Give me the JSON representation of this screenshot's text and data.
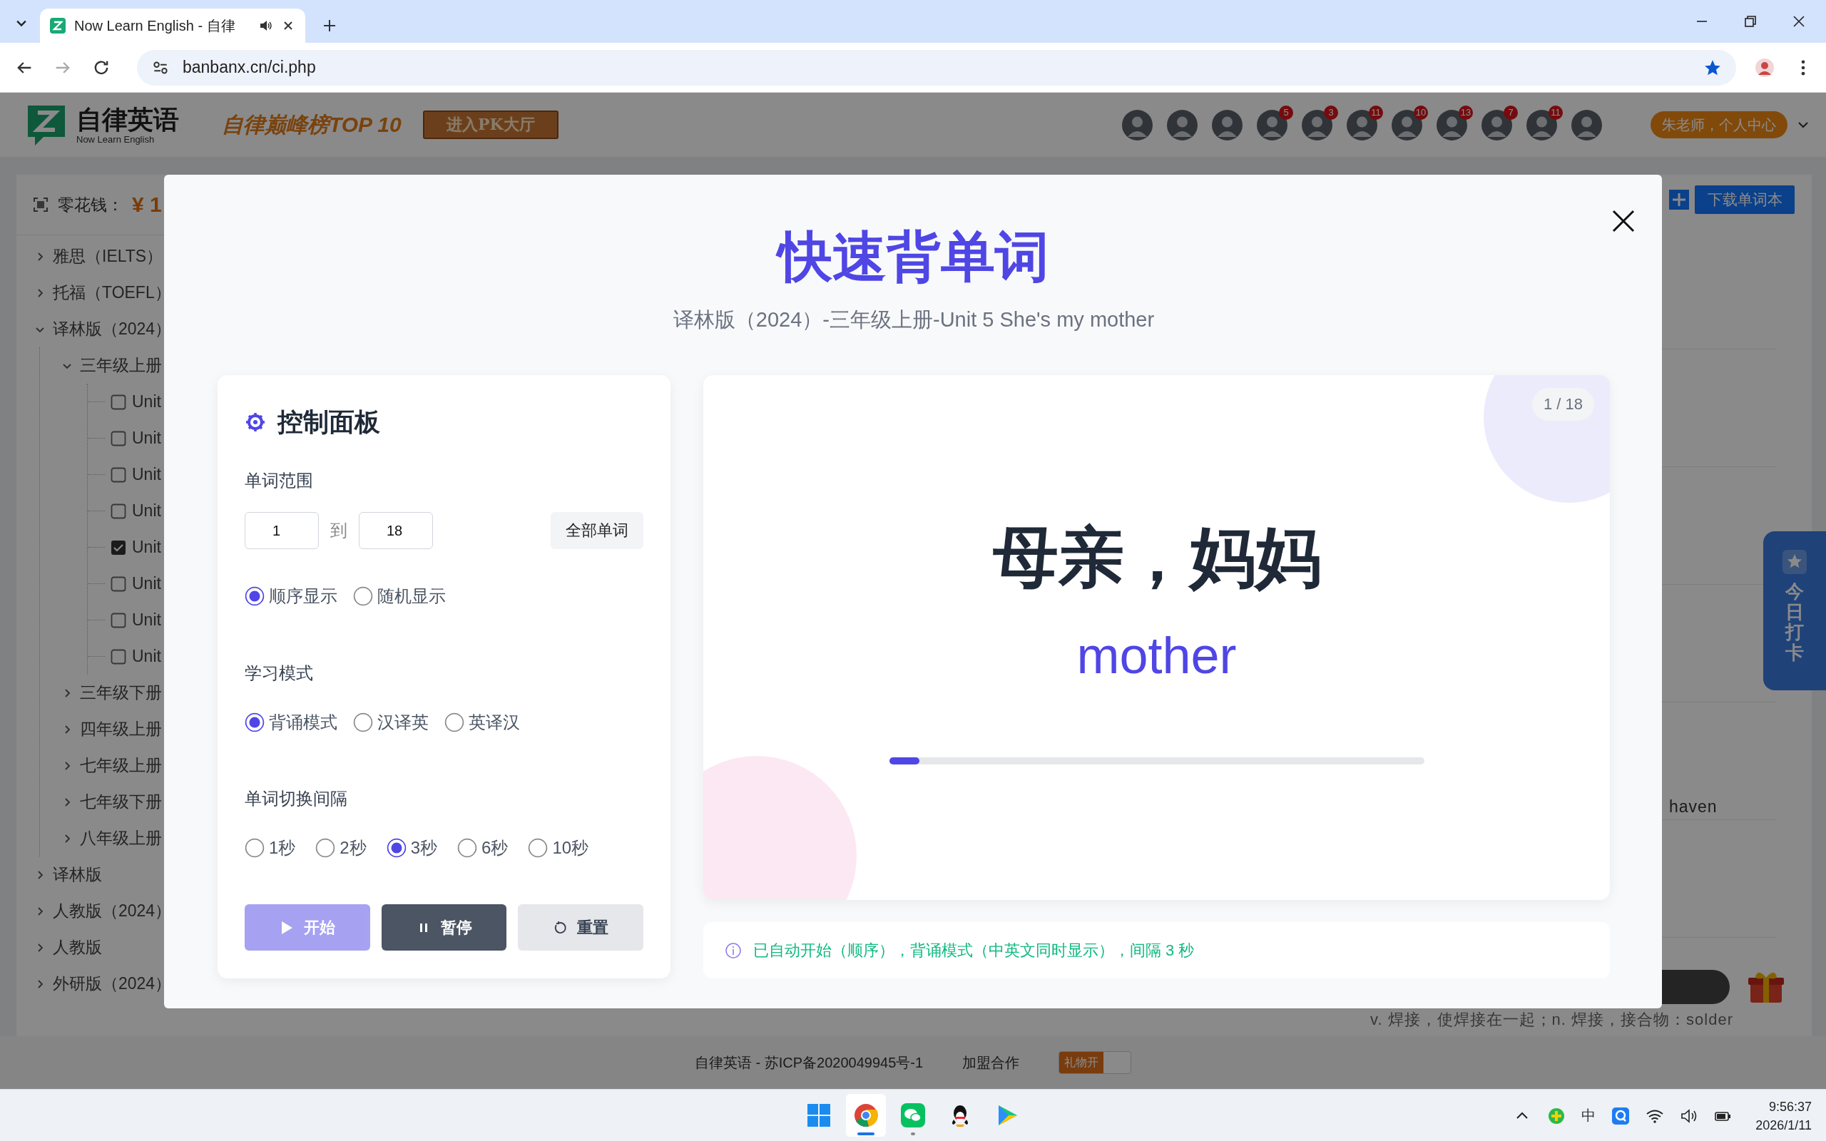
{
  "browser": {
    "tab_title": "Now Learn English - 自律",
    "url": "banbanx.cn/ci.php"
  },
  "site_header": {
    "logo_title": "自律英语",
    "logo_subtitle": "Now Learn English",
    "ranking": "自律巅峰榜TOP 10",
    "pk_button": "进入PK大厅",
    "avatars": [
      {
        "kind": "plain"
      },
      {
        "kind": "plain"
      },
      {
        "kind": "plain"
      },
      {
        "kind": "badged",
        "badge": "5"
      },
      {
        "kind": "badged",
        "badge": "3"
      },
      {
        "kind": "badged",
        "badge": "11"
      },
      {
        "kind": "badged",
        "badge": "10"
      },
      {
        "kind": "badged",
        "badge": "13"
      },
      {
        "kind": "badged",
        "badge": "7"
      },
      {
        "kind": "badged",
        "badge": "11"
      },
      {
        "kind": "plain"
      }
    ],
    "user_menu": "朱老师，个人中心"
  },
  "sidebar": {
    "allowance_label": "零花钱：",
    "allowance_value": "¥ 1",
    "tree": [
      {
        "kind": "folder",
        "label": "雅思（IELTS）",
        "expanded": false
      },
      {
        "kind": "folder",
        "label": "托福（TOEFL）",
        "expanded": false
      },
      {
        "kind": "folder",
        "label": "译林版（2024）",
        "expanded": true,
        "children": [
          {
            "kind": "folder",
            "label": "三年级上册",
            "expanded": true,
            "children": [
              {
                "kind": "checkbox",
                "label": "Unit",
                "checked": false
              },
              {
                "kind": "checkbox",
                "label": "Unit",
                "checked": false
              },
              {
                "kind": "checkbox",
                "label": "Unit",
                "checked": false
              },
              {
                "kind": "checkbox",
                "label": "Unit",
                "checked": false
              },
              {
                "kind": "checkbox",
                "label": "Unit",
                "checked": true
              },
              {
                "kind": "checkbox",
                "label": "Unit",
                "checked": false
              },
              {
                "kind": "checkbox",
                "label": "Unit",
                "checked": false
              },
              {
                "kind": "checkbox",
                "label": "Unit",
                "checked": false
              }
            ]
          },
          {
            "kind": "folder",
            "label": "三年级下册",
            "expanded": false
          },
          {
            "kind": "folder",
            "label": "四年级上册",
            "expanded": false
          },
          {
            "kind": "folder",
            "label": "七年级上册",
            "expanded": false
          },
          {
            "kind": "folder",
            "label": "七年级下册",
            "expanded": false
          },
          {
            "kind": "folder",
            "label": "八年级上册",
            "expanded": false
          }
        ]
      },
      {
        "kind": "folder",
        "label": "译林版",
        "expanded": false
      },
      {
        "kind": "folder",
        "label": "人教版（2024）",
        "expanded": false
      },
      {
        "kind": "folder",
        "label": "人教版",
        "expanded": false
      },
      {
        "kind": "folder",
        "label": "外研版（2024）",
        "expanded": false
      }
    ]
  },
  "word_list": {
    "download_button": "下载单词本",
    "word": "haven",
    "definition": "v. 焊接，使焊接在一起；n. 焊接，接合物：solder"
  },
  "checkin_tab": "今日打卡",
  "footer": {
    "copyright": "自律英语 - 苏ICP备2020049945号-1",
    "partner_link": "加盟合作",
    "gift_toggle": {
      "label": "礼物开",
      "on": true
    }
  },
  "modal": {
    "title": "快速背单词",
    "subtitle": "译林版（2024）-三年级上册-Unit 5 She's my mother",
    "control_panel": {
      "title": "控制面板",
      "range": {
        "label": "单词范围",
        "from": "1",
        "separator": "到",
        "to": "18",
        "all_button": "全部单词"
      },
      "order_options": [
        {
          "label": "顺序显示",
          "selected": true
        },
        {
          "label": "随机显示",
          "selected": false
        }
      ],
      "mode": {
        "label": "学习模式",
        "options": [
          {
            "label": "背诵模式",
            "selected": true
          },
          {
            "label": "汉译英",
            "selected": false
          },
          {
            "label": "英译汉",
            "selected": false
          }
        ]
      },
      "interval": {
        "label": "单词切换间隔",
        "options": [
          {
            "label": "1秒",
            "selected": false
          },
          {
            "label": "2秒",
            "selected": false
          },
          {
            "label": "3秒",
            "selected": true
          },
          {
            "label": "6秒",
            "selected": false
          },
          {
            "label": "10秒",
            "selected": false
          }
        ]
      },
      "buttons": [
        {
          "kind": "start",
          "label": "开始",
          "disabled": true
        },
        {
          "kind": "pause",
          "label": "暂停",
          "disabled": false
        },
        {
          "kind": "reset",
          "label": "重置",
          "disabled": false
        }
      ]
    },
    "word_card": {
      "counter": "1 / 18",
      "chinese": "母亲，妈妈",
      "english": "mother",
      "progress": {
        "level": 0.056
      }
    },
    "status_message": "已自动开始（顺序），背诵模式（中英文同时显示），间隔 3 秒"
  },
  "taskbar": {
    "ime": "中",
    "time": "9:56:37",
    "date": "2026/1/11"
  }
}
